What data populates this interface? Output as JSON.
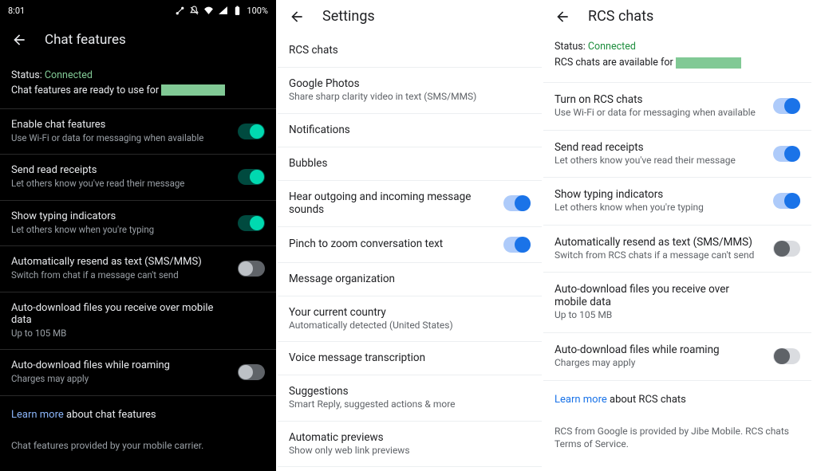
{
  "panel1": {
    "statusbar": {
      "time": "8:01",
      "battery": "100%"
    },
    "title": "Chat features",
    "status_label": "Status:",
    "status_value": "Connected",
    "ready_text": "Chat features are ready to use for",
    "rows": [
      {
        "title": "Enable chat features",
        "sub": "Use Wi-Fi or data for messaging when available",
        "on": true
      },
      {
        "title": "Send read receipts",
        "sub": "Let others know you've read their message",
        "on": true
      },
      {
        "title": "Show typing indicators",
        "sub": "Let others know when you're typing",
        "on": true
      },
      {
        "title": "Automatically resend as text (SMS/MMS)",
        "sub": "Switch from chat if a message can't send",
        "on": false
      },
      {
        "title": "Auto-download files you receive over mobile data",
        "sub": "Up to 105 MB",
        "on": null
      },
      {
        "title": "Auto-download files while roaming",
        "sub": "Charges may apply",
        "on": false
      }
    ],
    "learn_more": "Learn more",
    "learn_more_suffix": " about chat features",
    "footer": "Chat features provided by your mobile carrier."
  },
  "panel2": {
    "title": "Settings",
    "rows": [
      {
        "title": "RCS chats",
        "sub": ""
      },
      {
        "title": "Google Photos",
        "sub": "Share sharp clarity video in text (SMS/MMS)"
      },
      {
        "title": "Notifications",
        "sub": ""
      },
      {
        "title": "Bubbles",
        "sub": ""
      },
      {
        "title": "Hear outgoing and incoming message sounds",
        "sub": "",
        "toggle": true,
        "on": true
      },
      {
        "title": "Pinch to zoom conversation text",
        "sub": "",
        "toggle": true,
        "on": true
      },
      {
        "title": "Message organization",
        "sub": ""
      },
      {
        "title": "Your current country",
        "sub": "Automatically detected (United States)"
      },
      {
        "title": "Voice message transcription",
        "sub": ""
      },
      {
        "title": "Suggestions",
        "sub": "Smart Reply, suggested actions & more"
      },
      {
        "title": "Automatic previews",
        "sub": "Show only web link previews"
      }
    ]
  },
  "panel3": {
    "title": "RCS chats",
    "status_label": "Status:",
    "status_value": "Connected",
    "avail_text": "RCS chats are available for",
    "rows": [
      {
        "title": "Turn on RCS chats",
        "sub": "Use Wi-Fi or data for messaging when available",
        "on": true
      },
      {
        "title": "Send read receipts",
        "sub": "Let others know you've read their message",
        "on": true
      },
      {
        "title": "Show typing indicators",
        "sub": "Let others know when you're typing",
        "on": true
      },
      {
        "title": "Automatically resend as text (SMS/MMS)",
        "sub": "Switch from RCS chats if a message can't send",
        "on": false
      },
      {
        "title": "Auto-download files you receive over mobile data",
        "sub": "Up to 105 MB",
        "on": null
      },
      {
        "title": "Auto-download files while roaming",
        "sub": "Charges may apply",
        "on": false
      }
    ],
    "learn_more": "Learn more",
    "learn_more_suffix": " about RCS chats",
    "footer": "RCS from Google is provided by Jibe Mobile. RCS chats Terms of Service."
  }
}
